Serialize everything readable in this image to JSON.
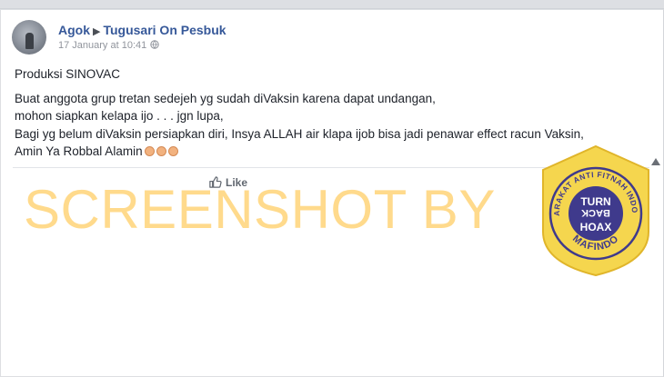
{
  "post": {
    "author": "Agok",
    "group": "Tugusari On Pesbuk",
    "timestamp": "17 January at 10:41",
    "lines": [
      "Produksi SINOVAC",
      "Buat anggota grup tretan sedejeh yg sudah diVaksin karena dapat undangan,",
      "mohon siapkan kelapa ijo . . . jgn lupa,",
      "Bagi yg belum diVaksin persiapkan diri, Insya ALLAH air klapa ijob bisa jadi penawar effect racun Vaksin,",
      "Amin Ya Robbal Alamin"
    ]
  },
  "actions": {
    "like_label": "Like"
  },
  "watermark": {
    "text": "SCREENSHOT BY"
  },
  "badge": {
    "ring_text": "MASYARAKAT ANTI FITNAH INDONESIA",
    "line1": "TURN",
    "line2": "BACK",
    "line3": "HOAX",
    "bottom": "MAFINDO"
  },
  "colors": {
    "link": "#365899",
    "watermark": "#ffc446",
    "badge_fill": "#f5d64e",
    "badge_ring": "#3f3a8c"
  }
}
